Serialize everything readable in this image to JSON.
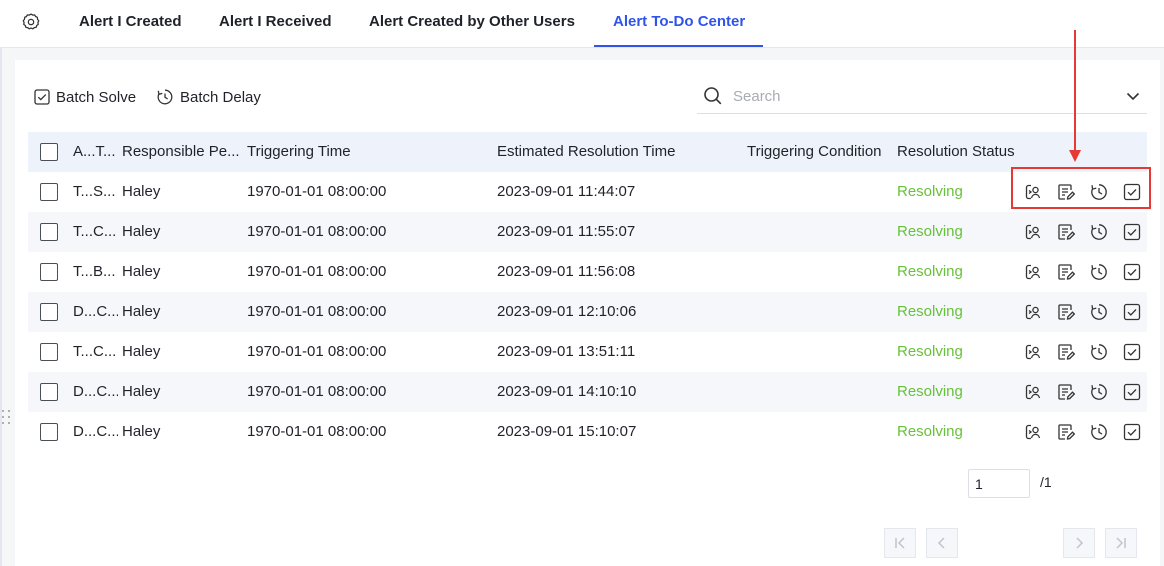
{
  "tabs": [
    {
      "label": "Alert I Created",
      "active": false
    },
    {
      "label": "Alert I Received",
      "active": false
    },
    {
      "label": "Alert Created by Other Users",
      "active": false
    },
    {
      "label": "Alert To-Do Center",
      "active": true
    }
  ],
  "toolbar": {
    "batch_solve": "Batch Solve",
    "batch_delay": "Batch Delay",
    "search_placeholder": "Search"
  },
  "table": {
    "columns": [
      "A...T...",
      "Responsible Pe...",
      "Triggering Time",
      "Estimated Resolution Time",
      "Triggering Condition",
      "Resolution Status"
    ],
    "rows": [
      {
        "name": "T...S...",
        "person": "Haley",
        "trigger_time": "1970-01-01 08:00:00",
        "est_time": "2023-09-01 11:44:07",
        "condition": "",
        "status": "Resolving"
      },
      {
        "name": "T...C...",
        "person": "Haley",
        "trigger_time": "1970-01-01 08:00:00",
        "est_time": "2023-09-01 11:55:07",
        "condition": "",
        "status": "Resolving"
      },
      {
        "name": "T...B...",
        "person": "Haley",
        "trigger_time": "1970-01-01 08:00:00",
        "est_time": "2023-09-01 11:56:08",
        "condition": "",
        "status": "Resolving"
      },
      {
        "name": "D...C...",
        "person": "Haley",
        "trigger_time": "1970-01-01 08:00:00",
        "est_time": "2023-09-01 12:10:06",
        "condition": "",
        "status": "Resolving"
      },
      {
        "name": "T...C...",
        "person": "Haley",
        "trigger_time": "1970-01-01 08:00:00",
        "est_time": "2023-09-01 13:51:11",
        "condition": "",
        "status": "Resolving"
      },
      {
        "name": "D...C...",
        "person": "Haley",
        "trigger_time": "1970-01-01 08:00:00",
        "est_time": "2023-09-01 14:10:10",
        "condition": "",
        "status": "Resolving"
      },
      {
        "name": "D...C...",
        "person": "Haley",
        "trigger_time": "1970-01-01 08:00:00",
        "est_time": "2023-09-01 15:10:07",
        "condition": "",
        "status": "Resolving"
      }
    ],
    "row_actions": [
      "transfer-icon",
      "edit-note-icon",
      "delay-icon",
      "solve-icon"
    ]
  },
  "pagination": {
    "current_page": "1",
    "total": "/1"
  },
  "colors": {
    "accent": "#2f54eb",
    "status_resolving": "#67c23a",
    "annotation": "#e53935"
  }
}
